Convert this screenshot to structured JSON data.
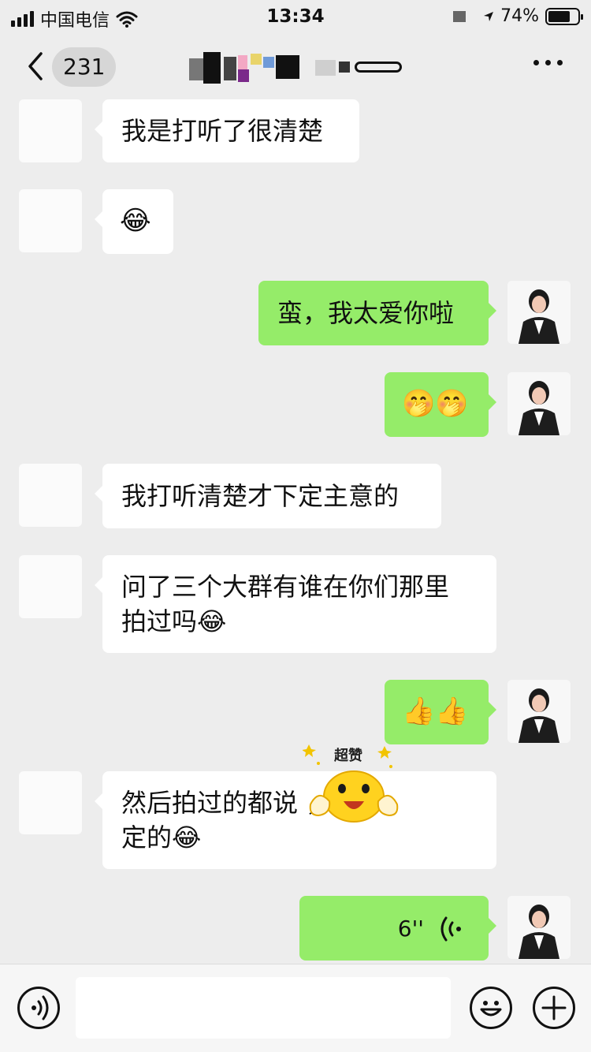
{
  "status_bar": {
    "carrier": "中国电信",
    "time": "13:34",
    "battery_percent": "74%",
    "battery_level": 0.74
  },
  "nav": {
    "back_count": "231"
  },
  "messages": [
    {
      "side": "in",
      "text": "我是打听了很清楚"
    },
    {
      "side": "in",
      "text": "😂"
    },
    {
      "side": "out",
      "text": "蛮，我太爱你啦"
    },
    {
      "side": "out",
      "text": "🤭🤭"
    },
    {
      "side": "in",
      "text": "我打听清楚才下定主意的"
    },
    {
      "side": "in",
      "text": "问了三个大群有谁在你们那里\n拍过吗😂"
    },
    {
      "side": "out",
      "text": "👍👍"
    },
    {
      "side": "in",
      "text": "然后拍过的都说 ，我才\n定的😂"
    },
    {
      "side": "out",
      "type": "voice",
      "duration": "6''"
    }
  ],
  "sticker": {
    "label": "超赞"
  },
  "input_bar": {
    "placeholder": ""
  },
  "colors": {
    "background": "#ededed",
    "bubble_out": "#95ec69",
    "bubble_in": "#ffffff"
  }
}
